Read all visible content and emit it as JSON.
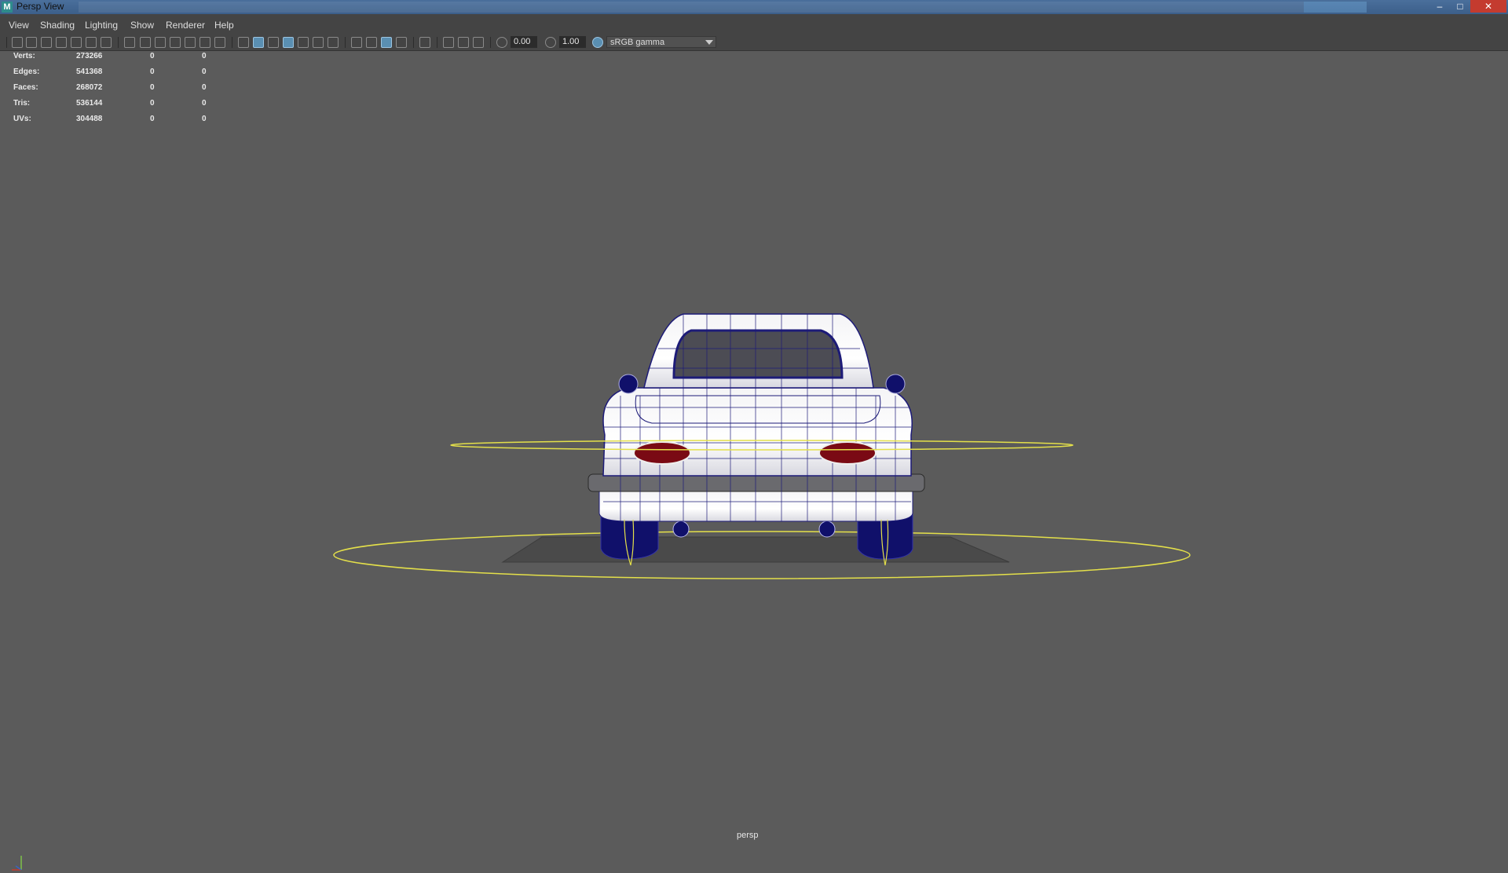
{
  "window": {
    "title": "Persp View",
    "app_icon": "M",
    "controls": [
      "minimize-icon",
      "restore-icon",
      "close-icon"
    ]
  },
  "menubar": {
    "items": [
      "View",
      "Shading",
      "Lighting",
      "Show",
      "Renderer",
      "Help"
    ]
  },
  "toolbar": {
    "exposure_value": "0.00",
    "gamma_value": "1.00",
    "color_space": "sRGB gamma",
    "accent_color": "#5a8fb2"
  },
  "hud": {
    "rows": [
      {
        "label": "Verts:",
        "values": [
          "273266",
          "0",
          "0"
        ]
      },
      {
        "label": "Edges:",
        "values": [
          "541368",
          "0",
          "0"
        ]
      },
      {
        "label": "Faces:",
        "values": [
          "268072",
          "0",
          "0"
        ]
      },
      {
        "label": "Tris:",
        "values": [
          "536144",
          "0",
          "0"
        ]
      },
      {
        "label": "UVs:",
        "values": [
          "304488",
          "0",
          "0"
        ]
      }
    ]
  },
  "viewport": {
    "camera": "persp",
    "background_color": "#5b5b5b",
    "wire_color": "#1d1b78",
    "curve_color": "#e4e04a",
    "taillight_color": "#7a0a14"
  }
}
